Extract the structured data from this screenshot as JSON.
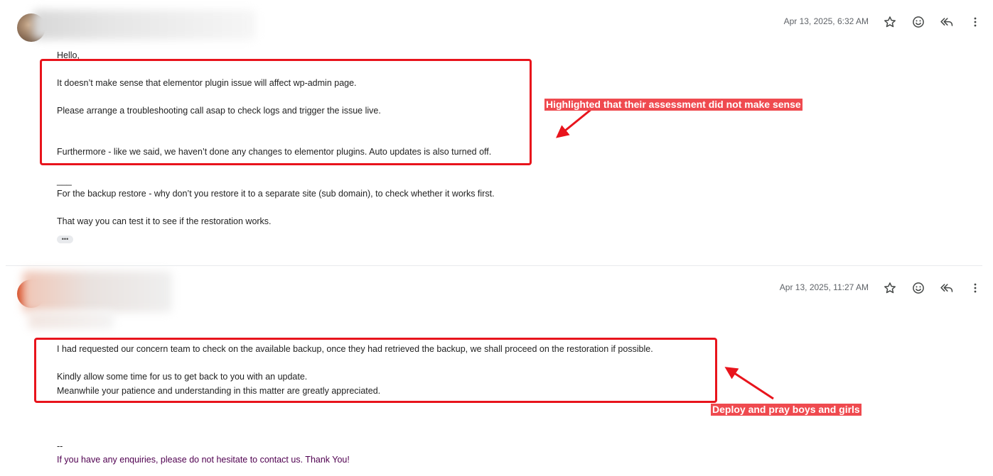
{
  "messages": [
    {
      "timestamp": "Apr 13, 2025, 6:32 AM",
      "body": {
        "greeting": "Hello,",
        "line1": "It doesn’t make sense that elementor plugin issue will affect wp-admin page.",
        "line2": "Please arrange a troubleshooting call asap to check logs and trigger the issue live.",
        "line3": "Furthermore - like we said, we haven’t done any changes to elementor plugins.  Auto updates is also turned off.",
        "separator": "___",
        "line4": "For the backup restore - why don’t you restore it to a separate site (sub domain), to check whether it works first.",
        "line5": "That way you can test it to see if the restoration works."
      },
      "show_trimmed": "•••"
    },
    {
      "timestamp": "Apr 13, 2025, 11:27 AM",
      "body": {
        "line1": "I had requested our concern team to check on the available backup, once they had retrieved the backup, we shall proceed on the restoration if possible.",
        "line2": "Kindly allow some time for us to get back to you with an update.",
        "line3": "Meanwhile your patience and understanding in this matter are greatly appreciated.",
        "sig_dash": "--",
        "signature": "If you have any enquiries, please do not hesitate to contact us. Thank You!"
      }
    }
  ],
  "icons": {
    "star": "star-icon",
    "emoji": "add-reaction-icon",
    "reply_all": "reply-all-icon",
    "more": "more-vert-icon"
  },
  "annotations": {
    "note1": "Highlighted that their assessment did not make sense",
    "note2": "Deploy and pray boys and girls",
    "color": "#e8141c"
  },
  "colors": {
    "timestamp": "#5f6368",
    "signature": "#500050",
    "annotation_label_bg": "#ef4a4f"
  }
}
